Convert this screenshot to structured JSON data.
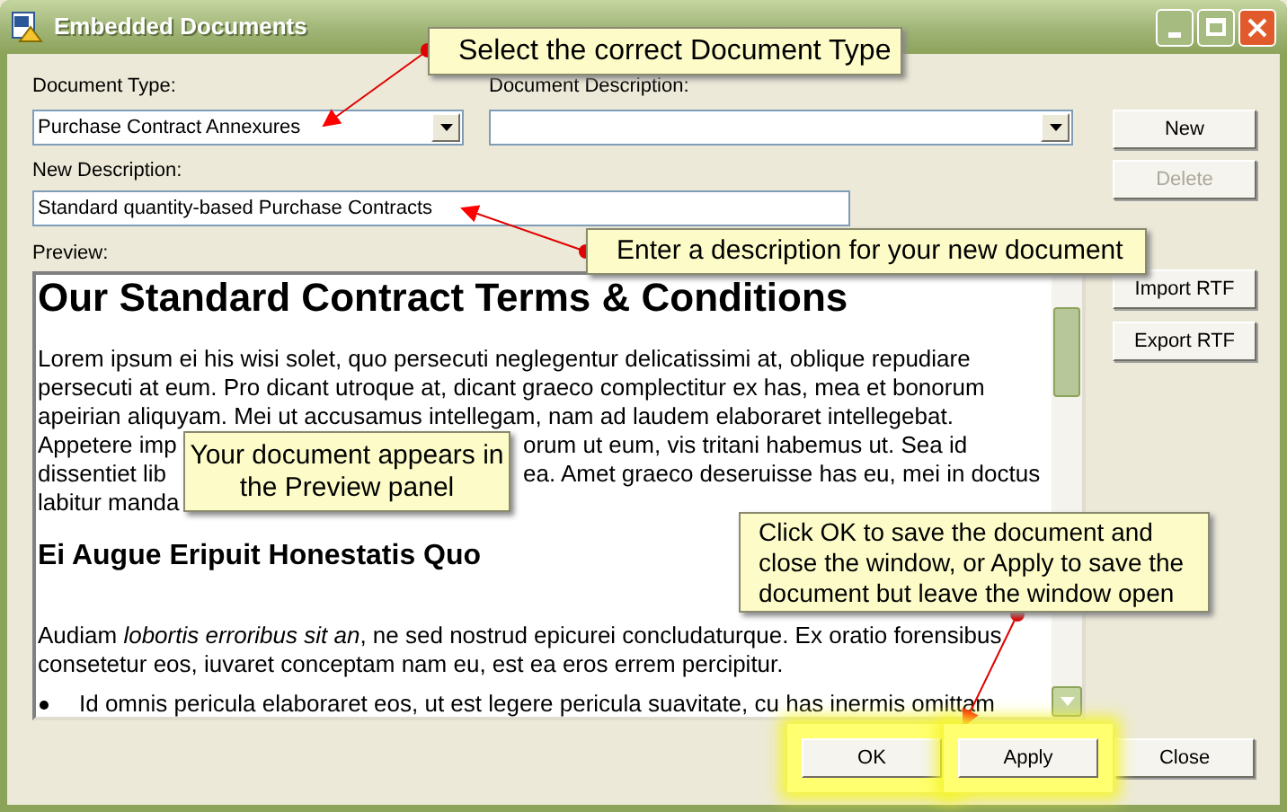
{
  "window": {
    "title": "Embedded Documents"
  },
  "fields": [
    {
      "label": "Document Type:",
      "kind": "combo",
      "value": "Purchase Contract Annexures"
    },
    {
      "label": "Document Description:",
      "kind": "combo"
    },
    {
      "label": "New Description:",
      "kind": "text",
      "value": "Standard quantity-based Purchase Contracts"
    }
  ],
  "side_buttons": [
    {
      "label": "New",
      "disabled": false
    },
    {
      "label": "Delete",
      "disabled": true
    },
    {
      "label": "Import RTF",
      "disabled": false
    },
    {
      "label": "Export RTF",
      "disabled": false
    }
  ],
  "preview": {
    "label": "Preview:",
    "blocks": [
      {
        "kind": "title",
        "text": "Our Standard Contract Terms & Conditions"
      },
      {
        "kind": "paragraph",
        "lines": [
          [
            "Lorem ipsum ei his wisi solet, quo persecuti neglegentur delicatissimi at, oblique repudiare"
          ],
          [
            "persecuti at eum. Pro dicant utroque at, dicant graeco complectitur ex has, mea et bonorum"
          ],
          [
            "apeirian aliquyam. Mei ut accusamus intellegam, nam ad laudem elaboraret intellegebat."
          ],
          [
            "Appetere imp",
            "orum ut eum, vis tritani habemus ut. Sea id"
          ],
          [
            "dissentiet lib",
            "ea. Amet graeco deseruisse has eu, mei in doctus"
          ],
          [
            "labitur manda"
          ]
        ]
      },
      {
        "kind": "heading",
        "text": "Ei Augue Eripuit Honestatis Quo"
      },
      {
        "kind": "paragraph",
        "lines": [
          [
            "Audiam *lobortis erroribus sit an*, ne sed nostrud epicurei concludaturque. Ex oratio forensibus"
          ],
          [
            "consetetur eos, iuvaret conceptam nam eu, est ea eros errem percipitur."
          ]
        ]
      },
      {
        "kind": "bullet",
        "text": "Id omnis pericula elaboraret eos, ut est legere pericula suavitate, cu has inermis omittam"
      }
    ]
  },
  "bottom_buttons": [
    {
      "label": "OK",
      "highlighted": true
    },
    {
      "label": "Apply",
      "highlighted": true
    },
    {
      "label": "Close",
      "highlighted": false
    }
  ],
  "callouts": [
    "Select the correct Document Type",
    "Enter a description for your new document",
    "Your document appears in the Preview panel",
    "Click OK to save the document and close the window, or Apply to save the document but leave the window open"
  ]
}
